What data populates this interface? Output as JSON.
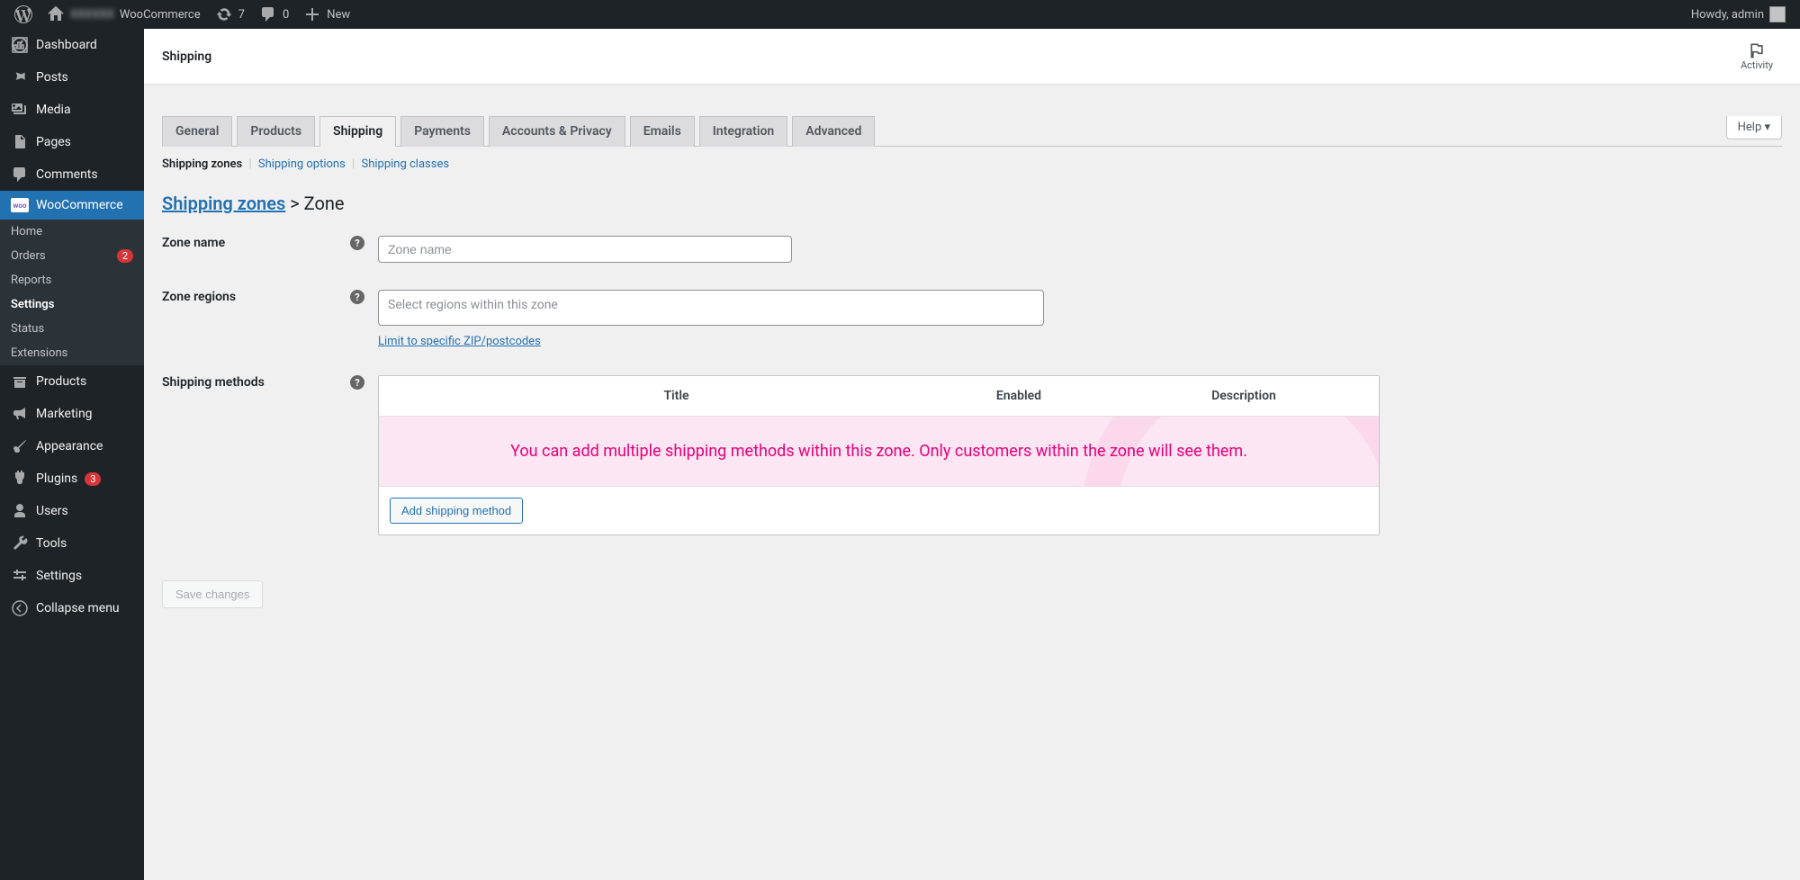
{
  "adminbar": {
    "site_name": "WooCommerce",
    "updates": "7",
    "comments": "0",
    "new": "New",
    "howdy": "Howdy, admin"
  },
  "sidebar": {
    "dashboard": "Dashboard",
    "posts": "Posts",
    "media": "Media",
    "pages": "Pages",
    "comments": "Comments",
    "woocommerce": "WooCommerce",
    "products": "Products",
    "marketing": "Marketing",
    "appearance": "Appearance",
    "plugins": "Plugins",
    "plugins_badge": "3",
    "users": "Users",
    "tools": "Tools",
    "settings": "Settings",
    "collapse": "Collapse menu",
    "sub": {
      "home": "Home",
      "orders": "Orders",
      "orders_badge": "2",
      "reports": "Reports",
      "settings": "Settings",
      "status": "Status",
      "extensions": "Extensions"
    }
  },
  "header": {
    "title": "Shipping",
    "activity": "Activity",
    "help": "Help"
  },
  "tabs": {
    "general": "General",
    "products": "Products",
    "shipping": "Shipping",
    "payments": "Payments",
    "accounts": "Accounts & Privacy",
    "emails": "Emails",
    "integration": "Integration",
    "advanced": "Advanced"
  },
  "subnav": {
    "zones": "Shipping zones",
    "options": "Shipping options",
    "classes": "Shipping classes"
  },
  "breadcrumb": {
    "link": "Shipping zones",
    "current": "Zone"
  },
  "form": {
    "zone_name_label": "Zone name",
    "zone_name_placeholder": "Zone name",
    "zone_regions_label": "Zone regions",
    "zone_regions_placeholder": "Select regions within this zone",
    "limit_link": "Limit to specific ZIP/postcodes",
    "shipping_methods_label": "Shipping methods"
  },
  "table": {
    "th_title": "Title",
    "th_enabled": "Enabled",
    "th_description": "Description",
    "empty_message": "You can add multiple shipping methods within this zone. Only customers within the zone will see them.",
    "add_button": "Add shipping method"
  },
  "save_button": "Save changes"
}
